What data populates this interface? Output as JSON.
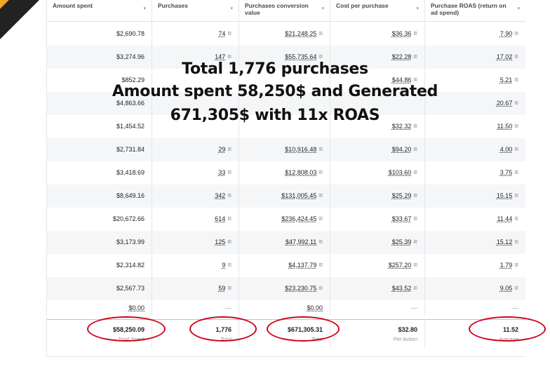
{
  "columns": [
    {
      "label": "Amount spent"
    },
    {
      "label": "Purchases"
    },
    {
      "label": "Purchases conversion value"
    },
    {
      "label": "Cost per purchase"
    },
    {
      "label": "Purchase ROAS (return on ad spend)"
    }
  ],
  "rows": [
    [
      "$2,690.78",
      "74",
      "$21,248.25",
      "$36.36",
      "7.90"
    ],
    [
      "$3,274.96",
      "147",
      "$55,735.64",
      "$22.28",
      "17.02"
    ],
    [
      "$852.29",
      "",
      "",
      "$44.86",
      "5.21"
    ],
    [
      "$4,863.66",
      "",
      "",
      "",
      "20.67"
    ],
    [
      "$1,454.52",
      "",
      "",
      "$32.32",
      "11.50"
    ],
    [
      "$2,731.84",
      "29",
      "$10,916.48",
      "$94.20",
      "4.00"
    ],
    [
      "$3,418.69",
      "33",
      "$12,808.03",
      "$103.60",
      "3.75"
    ],
    [
      "$8,649.16",
      "342",
      "$131,005.45",
      "$25.29",
      "15.15"
    ],
    [
      "$20,672.66",
      "614",
      "$236,424.45",
      "$33.67",
      "11.44"
    ],
    [
      "$3,173.99",
      "125",
      "$47,992.11",
      "$25.39",
      "15.12"
    ],
    [
      "$2,314.82",
      "9",
      "$4,137.79",
      "$257.20",
      "1.79"
    ],
    [
      "$2,567.73",
      "59",
      "$23,230.75",
      "$43.52",
      "9.05"
    ]
  ],
  "empty_row": [
    "$0.00",
    "—",
    "$0.00",
    "—",
    "—"
  ],
  "totals": [
    {
      "value": "$58,250.09",
      "sub": "Total Spent"
    },
    {
      "value": "1,776",
      "sub": "Total"
    },
    {
      "value": "$671,305.31",
      "sub": "Total"
    },
    {
      "value": "$32.80",
      "sub": "Per Action"
    },
    {
      "value": "11.52",
      "sub": "Average"
    }
  ],
  "overlay": {
    "line1": "Total 1,776 purchases",
    "line2": "Amount spent 58,250$ and Generated",
    "line3": "671,305$ with 11x ROAS"
  },
  "colors": {
    "highlight_circle": "#d0021b",
    "corner_band": "#f5a623",
    "corner_dark": "#222222"
  },
  "icons": {
    "sort": "chevron-down-icon",
    "info": "details-icon"
  }
}
